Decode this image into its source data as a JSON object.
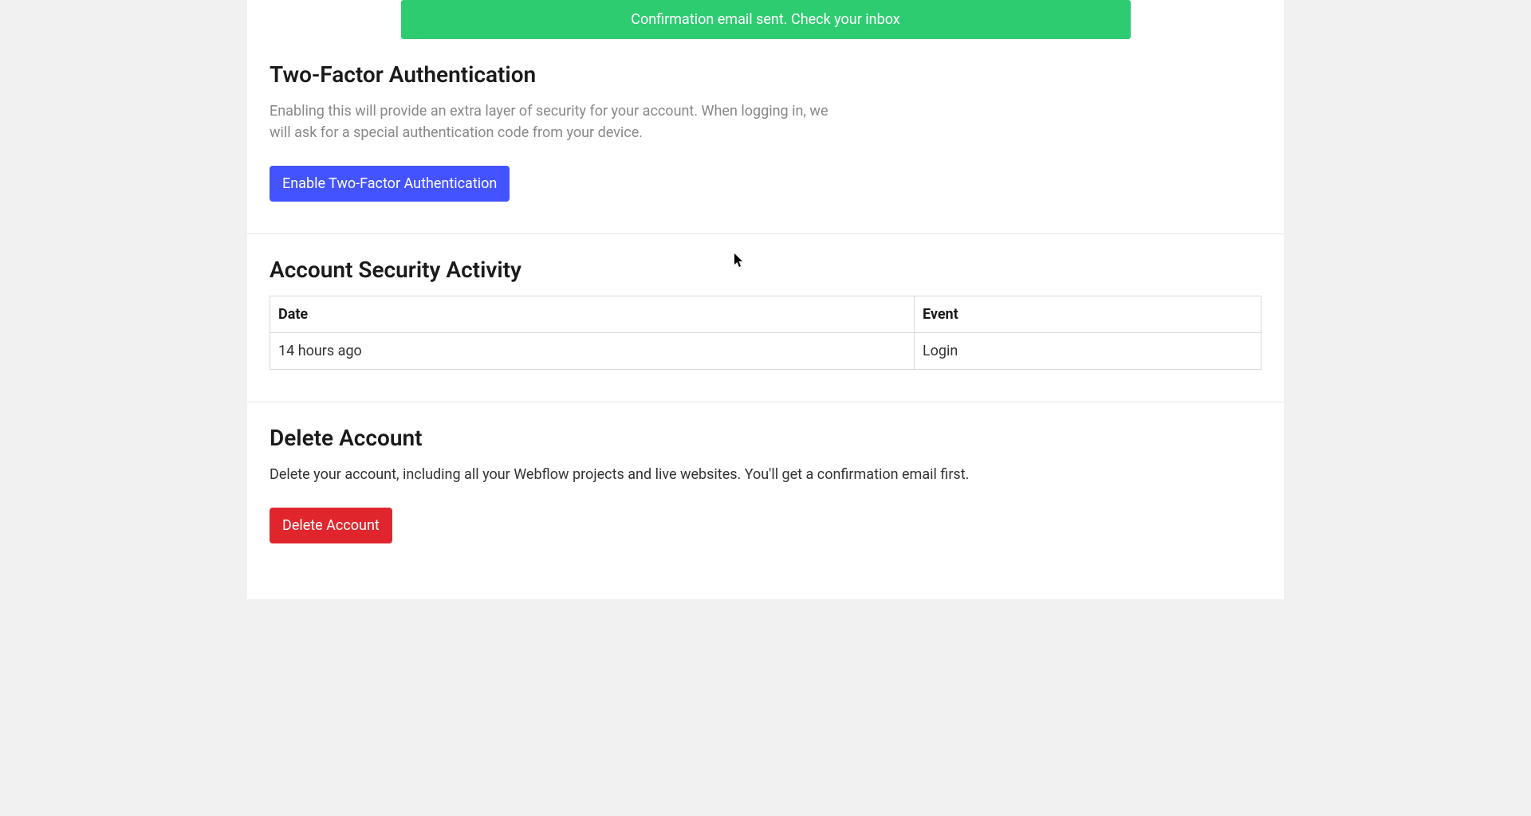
{
  "notification": {
    "message": "Confirmation email sent. Check your inbox"
  },
  "twofa": {
    "title": "Two-Factor Authentication",
    "description": "Enabling this will provide an extra layer of security for your account. When logging in, we will ask for a special authentication code from your device.",
    "button_label": "Enable Two-Factor Authentication"
  },
  "activity": {
    "title": "Account Security Activity",
    "columns": {
      "date": "Date",
      "event": "Event"
    },
    "rows": [
      {
        "date": "14 hours ago",
        "event": "Login"
      }
    ]
  },
  "delete_account": {
    "title": "Delete Account",
    "description": "Delete your account, including all your Webflow projects and live websites. You'll get a confirmation email first.",
    "button_label": "Delete Account"
  }
}
